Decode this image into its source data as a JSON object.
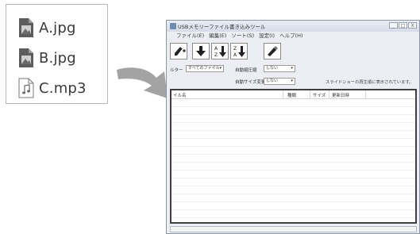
{
  "files": [
    {
      "name": "A.jpg",
      "icon": "image-file-icon"
    },
    {
      "name": "B.jpg",
      "icon": "image-file-icon"
    },
    {
      "name": "C.mp3",
      "icon": "audio-file-icon"
    }
  ],
  "window": {
    "title": "USBメモリーファイル書き込みツール",
    "controls": [
      "_",
      "□",
      "X"
    ]
  },
  "menu": [
    "ファイル(E)",
    "編集(E)",
    "ソート(S)",
    "設定(I)",
    "ヘルプ(H)"
  ],
  "toolbar": {
    "buttons": [
      "add-file",
      "move-down",
      "sort-az",
      "sort-za",
      "write"
    ]
  },
  "filter": {
    "label": "ルター",
    "value": "すべてのファイル"
  },
  "auto_compress": {
    "label": "自動縮圧縮",
    "value": "しない"
  },
  "auto_size": {
    "label": "自動サイズ変更",
    "value": "しない"
  },
  "note": "スライドショーの再生順に表示されています。",
  "columns": [
    "イル名",
    "種類",
    "サイズ",
    "更新日時"
  ],
  "colors": {
    "list_border": "#3f3f3f",
    "window_bg": "#eceef3",
    "arrow": "#9b9b9b"
  }
}
